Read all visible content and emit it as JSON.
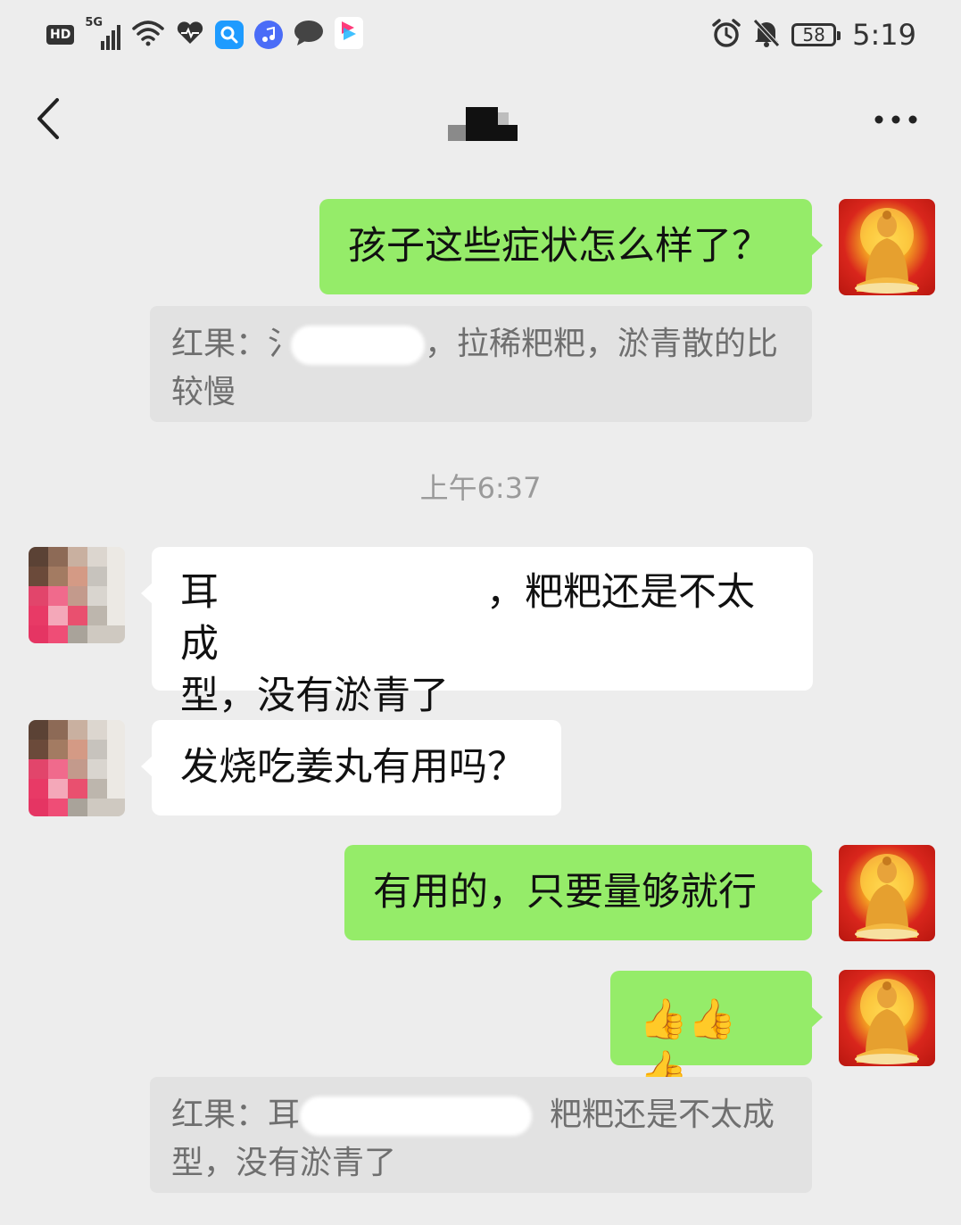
{
  "status_bar": {
    "hd_label": "HD",
    "network_label": "5G",
    "battery_level": "58",
    "time": "5:19",
    "icons": [
      "hd-icon",
      "signal-icon",
      "wifi-icon",
      "health-icon",
      "search-app-icon",
      "music-app-icon",
      "message-app-icon",
      "app-icon",
      "alarm-icon",
      "mute-icon",
      "battery-icon"
    ]
  },
  "navbar": {
    "back_icon": "chevron-left-icon",
    "more_icon": "more-dots-icon"
  },
  "messages": {
    "m1_text": "孩子这些症状怎么样了？",
    "quote1_prefix": "红果：",
    "quote1_visible_a": "氵",
    "quote1_visible_b": "，拉稀粑粑，淤青散的比",
    "quote1_line2": "较慢",
    "timestamp": "上午6:37",
    "m2_visible_a": "耳",
    "m2_visible_b": "，粑粑还是不太成",
    "m2_line2": "型，没有淤青了",
    "m3_text": "发烧吃姜丸有用吗？",
    "m4_text": "有用的，只要量够就行",
    "m5_emoji": "👍👍👍",
    "quote2_prefix": "红果：",
    "quote2_visible_a": "耳",
    "quote2_visible_b": "粑粑还是不太成",
    "quote2_line2": "型，没有淤青了"
  },
  "colors": {
    "background": "#ededed",
    "outgoing_bubble": "#95ec69",
    "incoming_bubble": "#ffffff",
    "quote_box": "#e2e2e2",
    "quote_text": "#6f6f6f",
    "timestamp_text": "#9a9a9a"
  }
}
